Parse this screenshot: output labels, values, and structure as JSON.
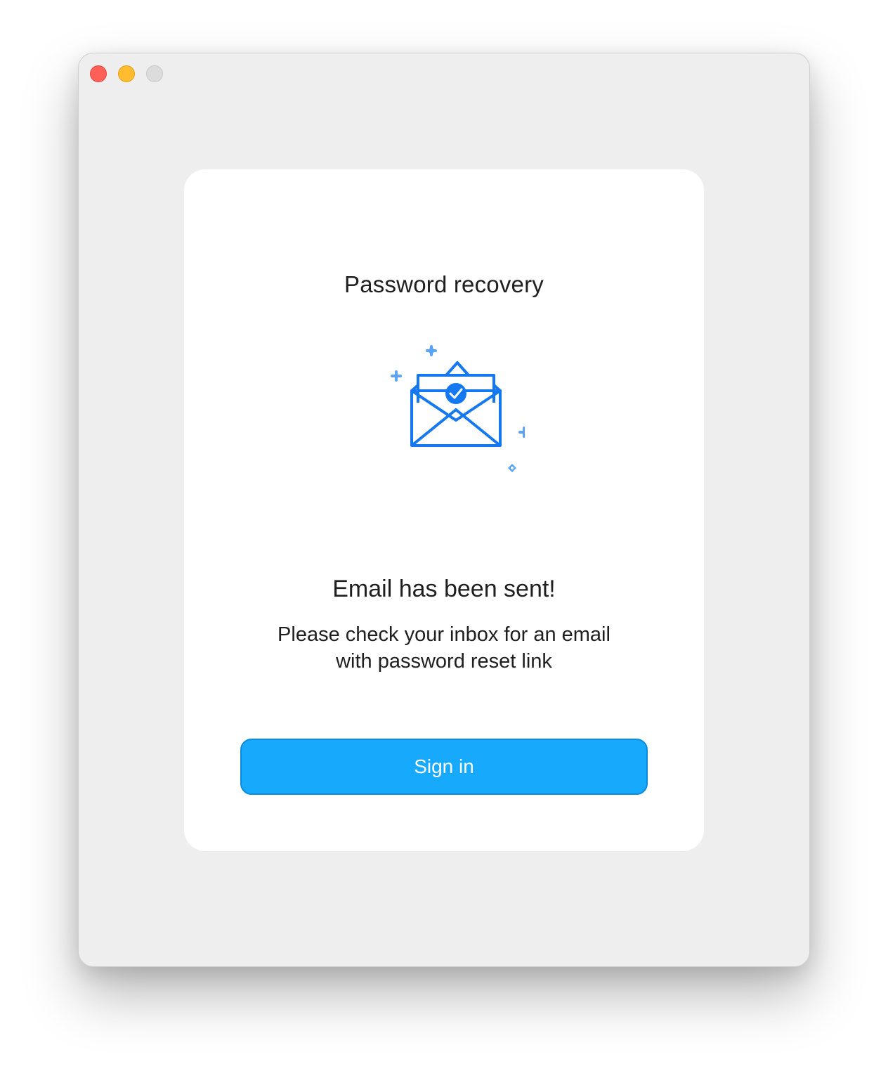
{
  "window": {
    "controls": {
      "close": "close-button",
      "minimize": "minimize-button",
      "zoom": "zoom-button"
    }
  },
  "card": {
    "title": "Password recovery",
    "illustration_icon": "envelope-check-icon",
    "heading": "Email has been sent!",
    "message_line1": "Please check your inbox for an email",
    "message_line2": "with password reset link",
    "signin_label": "Sign in"
  },
  "colors": {
    "accent": "#17a9fb",
    "icon_blue": "#1478f0",
    "sparkle_blue": "#5ba3f5"
  }
}
